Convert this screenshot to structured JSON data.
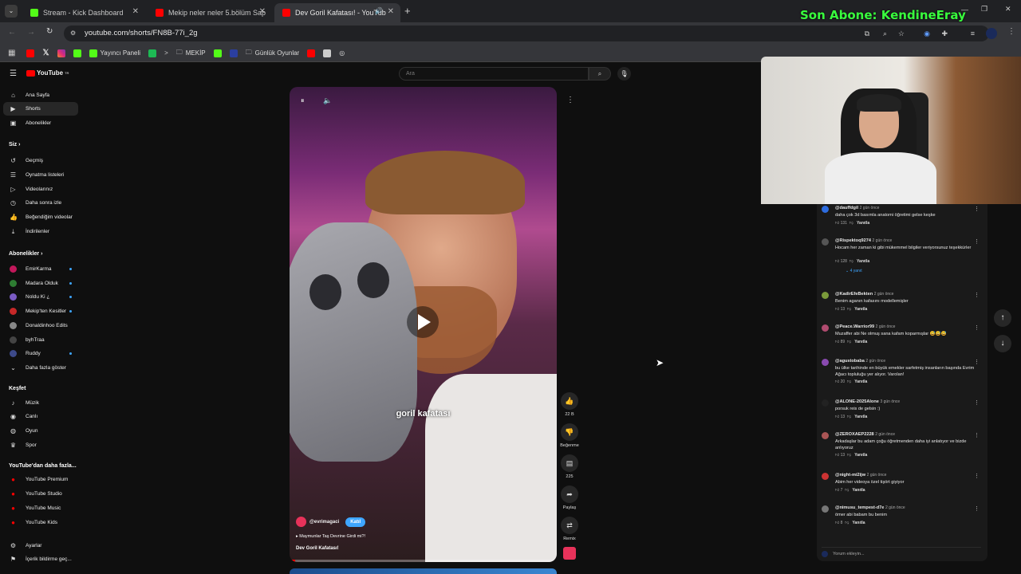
{
  "tabs": [
    {
      "label": "Stream - Kick Dashboard"
    },
    {
      "label": "Mekip neler neler 5.bölüm Sap"
    },
    {
      "label": "Dev Goril Kafatası! - YouTub"
    }
  ],
  "url": "youtube.com/shorts/FN8B-77i_2g",
  "bookmarks": {
    "yayinci": "Yayıncı Paneli",
    "mekip": "MEKİP",
    "gunluk": "Günlük Oyunlar"
  },
  "overlay": "Son Abone: KendineEray",
  "yt": {
    "logo": "YouTube",
    "logo_sup": "TR",
    "search_placeholder": "Ara"
  },
  "sidebar": {
    "main": [
      "Ana Sayfa",
      "Shorts",
      "Abonelikler"
    ],
    "you_head": "Siz",
    "you": [
      "Geçmiş",
      "Oynatma listeleri",
      "Videolarınız",
      "Daha sonra izle",
      "Beğendiğim videolar",
      "İndirilenler"
    ],
    "subs_head": "Abonelikler",
    "subs": [
      "EmirKarma",
      "Madara Olduk",
      "Noldu Ki ¿",
      "Mekip'ten Kesitler",
      "Donaldinhoo Edits",
      "byhTraa",
      "Ruddy"
    ],
    "show_more": "Daha fazla göster",
    "explore_head": "Keşfet",
    "explore": [
      "Müzik",
      "Canlı",
      "Oyun",
      "Spor"
    ],
    "more_head": "YouTube'dan daha fazla...",
    "more": [
      "YouTube Premium",
      "YouTube Studio",
      "YouTube Music",
      "YouTube Kids"
    ],
    "bottom": [
      "Ayarlar",
      "İçerik bildirme geç..."
    ]
  },
  "video": {
    "caption": "goril kafatası",
    "channel": "@evrimagaci",
    "join": "Katıl",
    "sub_text": "Maymunlar Taş Devrine Girdi mi?!",
    "title": "Dev Goril Kafatası!"
  },
  "actions": {
    "likes": "22 B",
    "dislike": "Beğenme",
    "comments": "225",
    "share": "Paylaş",
    "remix": "Remix"
  },
  "comments": [
    {
      "user": "@dauffdgil",
      "time": "2 gün önce",
      "text": "daha çok 3d basımla anatomi öğretimi gelse keşke",
      "likes": "131",
      "reply": "Yanıtla",
      "color": "#2d6cdf"
    },
    {
      "user": "@Rispektoq9274",
      "time": "2 gün önce",
      "text": "Hocam her zaman ki gibi mükemmel bilgiler veriyorsunuz teşekkürler",
      "likes": "128",
      "reply": "Yanıtla",
      "answers": "4 yanıt",
      "color": "#555"
    },
    {
      "user": "@KadirEfeBekten",
      "time": "2 gün önce",
      "text": "Benim aganın kafasını modellemişler",
      "likes": "13",
      "reply": "Yanıtla",
      "color": "#7a9a3a"
    },
    {
      "user": "@Peace.Warrior99",
      "time": "2 gün önce",
      "text": "Muzaffer abi Ne olmuş sana kafam koparmışlar 😅😅😅",
      "likes": "89",
      "reply": "Yanıtla",
      "color": "#b04b6f"
    },
    {
      "user": "@agustobaba",
      "time": "2 gün önce",
      "text": "bu ülke tarihinde en büyük emekler sarfetmiş insanların başında Evrim Ağacı topluluğu yer alıyor. Varolan!",
      "likes": "20",
      "reply": "Yanıtla",
      "color": "#8a4ab0"
    },
    {
      "user": "@ALONE-2025Alone",
      "time": "3 gün önce",
      "text": "porsuk reis de gelsin :)",
      "likes": "13",
      "reply": "Yanıtla",
      "color": "#222"
    },
    {
      "user": "@ZEROXAEP2228",
      "time": "2 gün önce",
      "text": "Arkadaşlar bu adam çoğu öğretmenden daha iyi anlatıyor ve bizde anlıyoruz",
      "likes": "13",
      "reply": "Yanıtla",
      "color": "#a55"
    },
    {
      "user": "@night-mi2ijw",
      "time": "2 gün önce",
      "text": "Abim her videoya özel tişört giyiyor",
      "likes": "7",
      "reply": "Yanıtla",
      "color": "#c33"
    },
    {
      "user": "@nimusu_tempest-d7e",
      "time": "2 gün önce",
      "text": "ömer abi babam bu benim",
      "likes": "8",
      "reply": "Yanıtla",
      "color": "#777"
    }
  ],
  "comment_input": "Yorum ekleyin..."
}
